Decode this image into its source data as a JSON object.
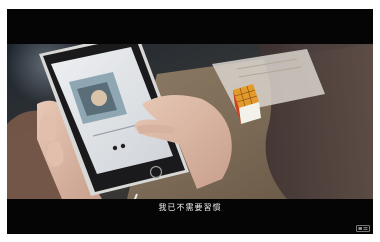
{
  "video": {
    "subtitle": "我已不需要習慣"
  },
  "watermark": {
    "icon": "channel-logo-icon"
  }
}
